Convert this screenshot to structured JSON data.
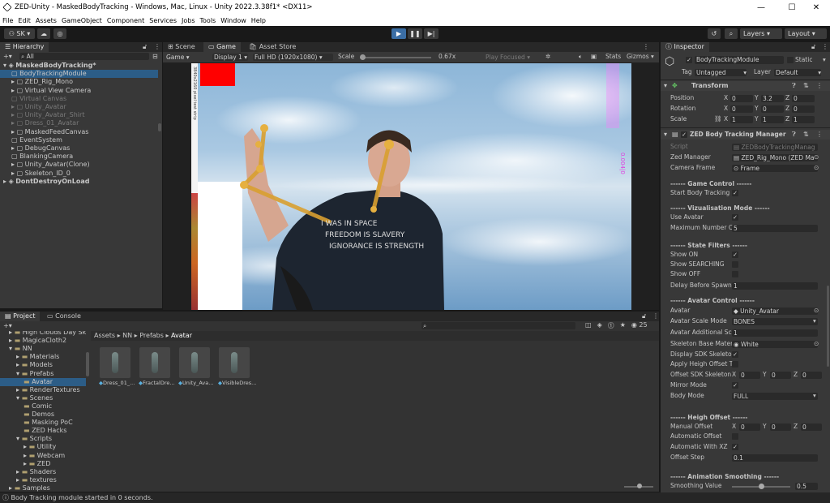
{
  "window": {
    "title": "ZED-Unity - MaskedBodyTracking - Windows, Mac, Linux - Unity 2022.3.38f1* <DX11>",
    "min": "—",
    "max": "☐",
    "close": "✕"
  },
  "menu": [
    "File",
    "Edit",
    "Assets",
    "GameObject",
    "Component",
    "Services",
    "Jobs",
    "Tools",
    "Window",
    "Help"
  ],
  "toolbar": {
    "account": "SK",
    "layers": "Layers",
    "layout": "Layout"
  },
  "hierarchy": {
    "tab": "Hierarchy",
    "search": "All",
    "items": [
      {
        "label": "MaskedBodyTracking*",
        "indent": 0,
        "type": "scene",
        "sel": false,
        "dim": false,
        "arrow": "▾"
      },
      {
        "label": "BodyTrackingModule",
        "indent": 1,
        "type": "go",
        "sel": true,
        "dim": false,
        "arrow": ""
      },
      {
        "label": "ZED_Rig_Mono",
        "indent": 1,
        "type": "go",
        "sel": false,
        "dim": false,
        "arrow": "▸"
      },
      {
        "label": "Virtual View Camera",
        "indent": 1,
        "type": "go",
        "sel": false,
        "dim": false,
        "arrow": "▸"
      },
      {
        "label": "Virtual Canvas",
        "indent": 1,
        "type": "go",
        "sel": false,
        "dim": true,
        "arrow": ""
      },
      {
        "label": "Unity_Avatar",
        "indent": 1,
        "type": "go",
        "sel": false,
        "dim": true,
        "arrow": "▸"
      },
      {
        "label": "Unity_Avatar_Shirt",
        "indent": 1,
        "type": "go",
        "sel": false,
        "dim": true,
        "arrow": "▸"
      },
      {
        "label": "Dress_01_Avatar",
        "indent": 1,
        "type": "go",
        "sel": false,
        "dim": true,
        "arrow": "▸"
      },
      {
        "label": "MaskedFeedCanvas",
        "indent": 1,
        "type": "go",
        "sel": false,
        "dim": false,
        "arrow": "▸"
      },
      {
        "label": "EventSystem",
        "indent": 1,
        "type": "go",
        "sel": false,
        "dim": false,
        "arrow": ""
      },
      {
        "label": "DebugCanvas",
        "indent": 1,
        "type": "go",
        "sel": false,
        "dim": false,
        "arrow": "▸"
      },
      {
        "label": "BlankingCamera",
        "indent": 1,
        "type": "go",
        "sel": false,
        "dim": false,
        "arrow": ""
      },
      {
        "label": "Unity_Avatar(Clone)",
        "indent": 1,
        "type": "go",
        "sel": false,
        "dim": false,
        "arrow": "▸"
      },
      {
        "label": "Skeleton_ID_0",
        "indent": 1,
        "type": "go",
        "sel": false,
        "dim": false,
        "arrow": "▸"
      },
      {
        "label": "DontDestroyOnLoad",
        "indent": 0,
        "type": "scene",
        "sel": false,
        "dim": false,
        "arrow": "▸"
      }
    ]
  },
  "viewtabs": {
    "scene": "Scene",
    "game": "Game",
    "store": "Asset Store"
  },
  "gamebar": {
    "mode": "Game",
    "display": "Display 1",
    "res": "Full HD (1920x1080)",
    "scale_label": "Scale",
    "scale_val": "0.67x",
    "play": "Play Focused",
    "stats": "Stats",
    "gizmos": "Gizmos"
  },
  "game": {
    "vtext": "3840x2160 pixel test strip",
    "vtext2": "0.004|0"
  },
  "project": {
    "tab": "Project",
    "console": "Console",
    "count": "25",
    "breadcrumb": [
      "Assets",
      "NN",
      "Prefabs",
      "Avatar"
    ],
    "tree": [
      {
        "label": "High Clouds Day Sk",
        "indent": 1,
        "arrow": "▸"
      },
      {
        "label": "MagicaCloth2",
        "indent": 1,
        "arrow": "▸"
      },
      {
        "label": "NN",
        "indent": 1,
        "arrow": "▾"
      },
      {
        "label": "Materials",
        "indent": 2,
        "arrow": "▸"
      },
      {
        "label": "Models",
        "indent": 2,
        "arrow": "▸"
      },
      {
        "label": "Prefabs",
        "indent": 2,
        "arrow": "▾"
      },
      {
        "label": "Avatar",
        "indent": 3,
        "arrow": "",
        "sel": true
      },
      {
        "label": "RenderTextures",
        "indent": 2,
        "arrow": "▸"
      },
      {
        "label": "Scenes",
        "indent": 2,
        "arrow": "▾"
      },
      {
        "label": "Comic",
        "indent": 3,
        "arrow": ""
      },
      {
        "label": "Demos",
        "indent": 3,
        "arrow": ""
      },
      {
        "label": "Masking PoC",
        "indent": 3,
        "arrow": ""
      },
      {
        "label": "ZED Hacks",
        "indent": 3,
        "arrow": ""
      },
      {
        "label": "Scripts",
        "indent": 2,
        "arrow": "▾"
      },
      {
        "label": "Utility",
        "indent": 3,
        "arrow": "▸"
      },
      {
        "label": "Webcam",
        "indent": 3,
        "arrow": "▸"
      },
      {
        "label": "ZED",
        "indent": 3,
        "arrow": "▸"
      },
      {
        "label": "Shaders",
        "indent": 2,
        "arrow": "▸"
      },
      {
        "label": "textures",
        "indent": 2,
        "arrow": "▸"
      },
      {
        "label": "Samples",
        "indent": 1,
        "arrow": "▸"
      }
    ],
    "assets": [
      "Dress_01_...",
      "FractalDre...",
      "Unity_Ava...",
      "VisibleDres..."
    ]
  },
  "status": "Body Tracking module started in 0 seconds.",
  "inspector": {
    "tab": "Inspector",
    "name": "BodyTrackingModule",
    "static": "Static",
    "tag_label": "Tag",
    "tag": "Untagged",
    "layer_label": "Layer",
    "layer": "Default",
    "transform": "Transform",
    "pos": "Position",
    "rot": "Rotation",
    "scale": "Scale",
    "pos_v": [
      "0",
      "3.2",
      "0"
    ],
    "rot_v": [
      "0",
      "0",
      "0"
    ],
    "scale_v": [
      "1",
      "1",
      "1"
    ],
    "comp": "ZED Body Tracking Manager (Sc",
    "script_l": "Script",
    "script_v": "ZEDBodyTrackingManag",
    "zedm_l": "Zed Manager",
    "zedm_v": "ZED_Rig_Mono (ZED Ma",
    "camf_l": "Camera Frame",
    "camf_v": "Frame",
    "h_game": "------ Game Control ------",
    "start_l": "Start Body Tracking",
    "h_viz": "------ Vizualisation Mode ------",
    "useav_l": "Use Avatar",
    "maxnb_l": "Maximum Number Of",
    "maxnb_v": "5",
    "h_state": "------ State Filters ------",
    "showon_l": "Show ON",
    "showsearch_l": "Show SEARCHING",
    "showoff_l": "Show OFF",
    "delay_l": "Delay Before Spawn",
    "delay_v": "1",
    "h_avatar": "------ Avatar Control ------",
    "avatar_l": "Avatar",
    "avatar_v": "Unity_Avatar",
    "avscale_l": "Avatar Scale Mode",
    "avscale_v": "BONES",
    "avadd_l": "Avatar Additional Sca",
    "avadd_v": "1",
    "skmat_l": "Skeleton Base Mater",
    "skmat_v": "White",
    "showsdk_l": "Display SDK Skeleton",
    "heigh_l": "Apply Heigh Offset T",
    "offsdk_l": "Offset SDK Skeleton",
    "offsdk_v": [
      "0",
      "0",
      "0"
    ],
    "mirror_l": "Mirror Mode",
    "bodymode_l": "Body Mode",
    "bodymode_v": "FULL",
    "h_heigh": "------ Heigh Offset ------",
    "manual_l": "Manual Offset",
    "manual_v": [
      "0",
      "0",
      "0"
    ],
    "auto_l": "Automatic Offset",
    "autoxz_l": "Automatic With XZ",
    "step_l": "Offset Step",
    "step_v": "0.1",
    "h_anim": "------ Animation Smoothing ------",
    "smooth_l": "Smoothing Value",
    "smooth_v": "0.5"
  }
}
